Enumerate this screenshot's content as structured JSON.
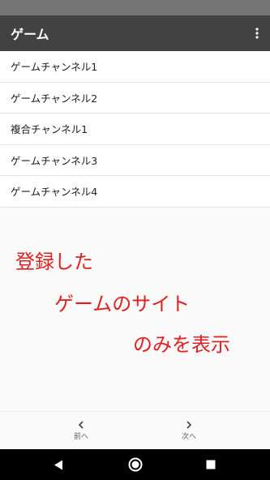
{
  "appbar": {
    "title": "ゲーム",
    "overflow_icon": "more-vert-icon"
  },
  "channels": [
    {
      "label": "ゲームチャンネル1"
    },
    {
      "label": "ゲームチャンネル2"
    },
    {
      "label": "複合チャンネル1"
    },
    {
      "label": "ゲームチャンネル3"
    },
    {
      "label": "ゲームチャンネル4"
    }
  ],
  "promo": {
    "line1": "登録した",
    "line2": "ゲームのサイト",
    "line3": "のみを表示",
    "color": "#e02020"
  },
  "bottom_nav": {
    "prev_label": "前へ",
    "next_label": "次へ"
  },
  "system_nav": {
    "back_icon": "back-triangle-icon",
    "home_icon": "home-circle-icon",
    "recents_icon": "recents-square-icon"
  }
}
